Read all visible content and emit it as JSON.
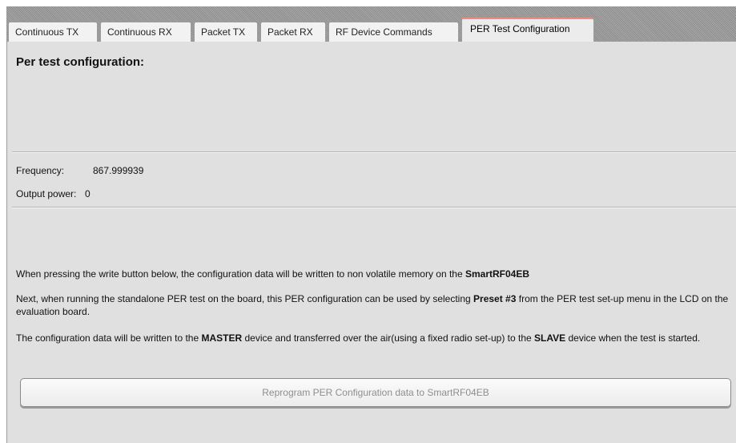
{
  "tabs": [
    {
      "label": "Continuous TX"
    },
    {
      "label": "Continuous RX"
    },
    {
      "label": "Packet TX"
    },
    {
      "label": "Packet RX"
    },
    {
      "label": "RF Device Commands"
    },
    {
      "label": "PER Test Configuration",
      "active": true
    }
  ],
  "panel": {
    "title": "Per test configuration:",
    "frequency_label": "Frequency:",
    "frequency_value": "867.999939",
    "output_power_label": "Output power:",
    "output_power_value": "0",
    "para1_pre": "When pressing the write button below, the configuration data will be written to non volatile memory on the ",
    "para1_bold": "SmartRF04EB",
    "para2_pre": "Next, when running the standalone PER test on the board, this PER configuration can be used by selecting ",
    "para2_bold": "Preset #3",
    "para2_post": " from the PER test set-up menu in the LCD on the evaluation board.",
    "para3_pre": "The configuration data will be written to the ",
    "para3_bold1": "MASTER",
    "para3_mid": " device and transferred over the air(using a fixed radio set-up) to the ",
    "para3_bold2": "SLAVE",
    "para3_post": " device when the test is started.",
    "button_label": "Reprogram PER Configuration data to SmartRF04EB"
  }
}
